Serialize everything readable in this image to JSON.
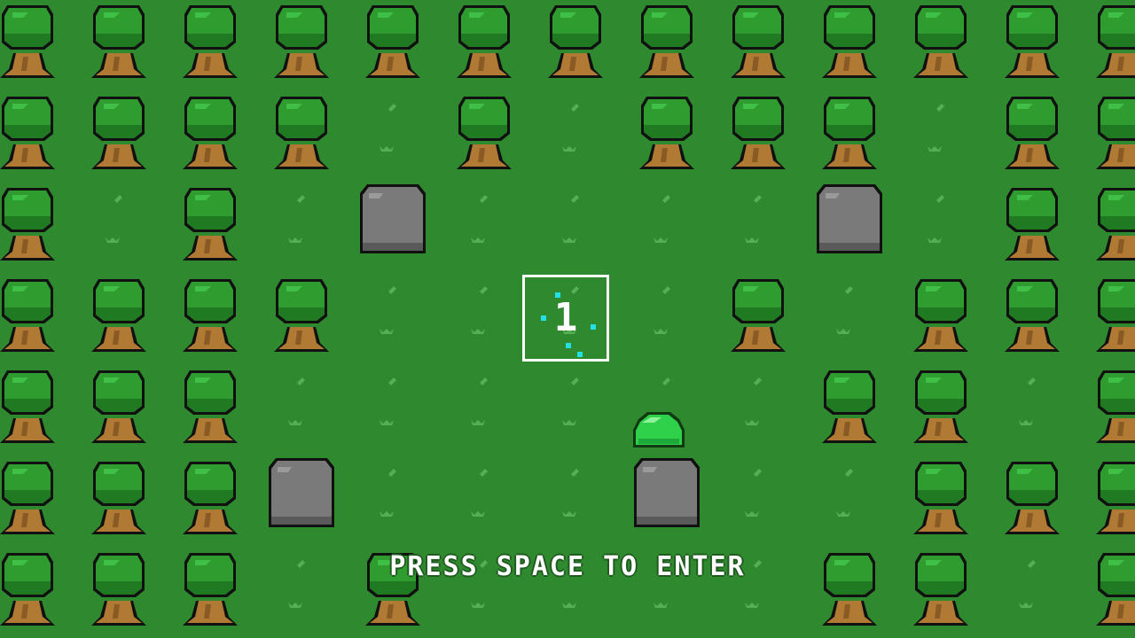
{
  "scene": {
    "background_color": "#2f8a2f",
    "map": [
      "TTTTTTTTTTTTT",
      "TTTT.T.TTT.TT",
      "T.T.R....R.TT",
      "TTTT....T.TTT",
      "TTT......TT.T",
      "TTTR...R..TTT",
      "TTT.T....TT.T"
    ],
    "legend": {
      "T": "tree",
      "R": "boulder",
      ".": "grass"
    }
  },
  "portal": {
    "number": "1",
    "color": "#ffffff",
    "sparkle_color": "#22e0e6"
  },
  "player": {
    "type": "green-slime",
    "color": "#2fd14a"
  },
  "hud": {
    "prompt": "PRESS SPACE TO ENTER"
  }
}
